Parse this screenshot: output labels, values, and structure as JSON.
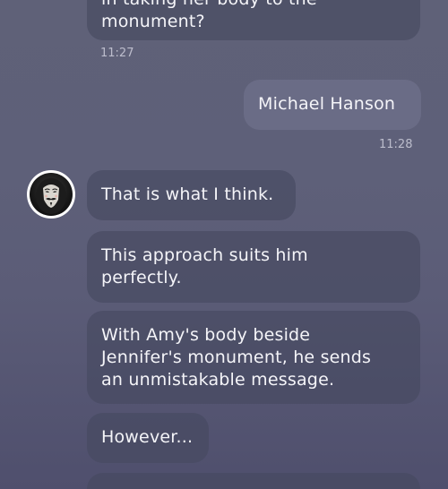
{
  "messages": [
    {
      "sender": "other",
      "lines": [
        "in taking her body to the",
        "monument?"
      ],
      "time": "11:27"
    },
    {
      "sender": "self",
      "lines": [
        "Michael Hanson"
      ],
      "time": "11:28"
    },
    {
      "sender": "other",
      "lines": [
        "That is what I think."
      ]
    },
    {
      "sender": "other",
      "lines": [
        "This approach suits him",
        "perfectly."
      ]
    },
    {
      "sender": "other",
      "lines": [
        "With Amy's body beside",
        "Jennifer's monument, he sends",
        "an unmistakable message."
      ]
    },
    {
      "sender": "other",
      "lines": [
        "However..."
      ]
    }
  ],
  "avatar": {
    "icon": "masked-face-avatar-icon"
  }
}
